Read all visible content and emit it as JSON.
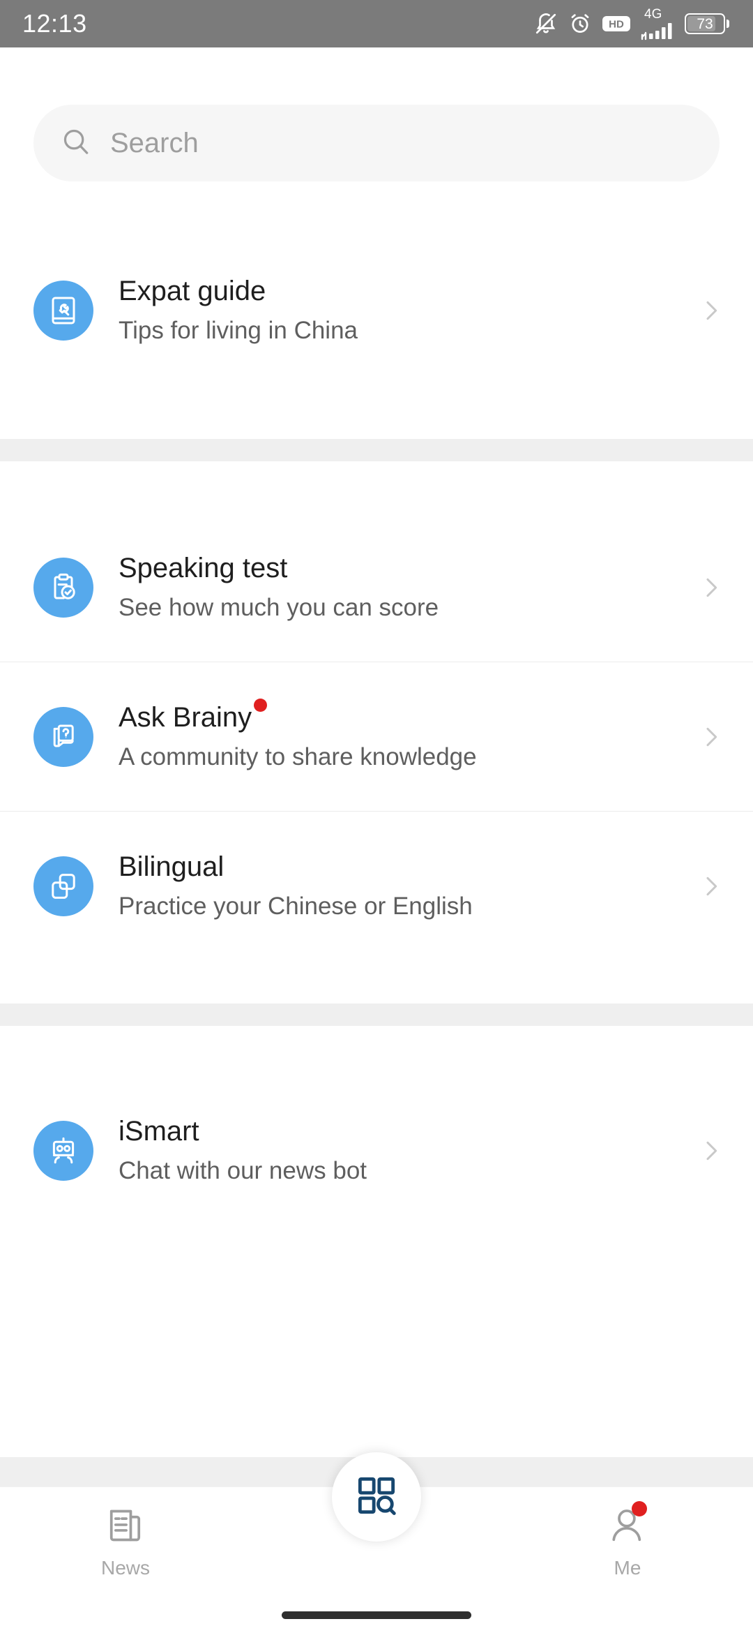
{
  "status_bar": {
    "time": "12:13",
    "network_type": "4G",
    "battery_level": "73",
    "icons": [
      "notifications-off-icon",
      "alarm-icon",
      "hd-icon",
      "signal-icon",
      "battery-icon"
    ]
  },
  "search": {
    "placeholder": "Search",
    "value": "",
    "icon": "search-icon"
  },
  "groups": [
    {
      "items": [
        {
          "id": "expat-guide",
          "title": "Expat guide",
          "subtitle": "Tips for living in China",
          "icon": "book-wrench-icon",
          "badge": false,
          "chevron": "chevron-right-icon"
        }
      ]
    },
    {
      "items": [
        {
          "id": "speaking-test",
          "title": "Speaking test",
          "subtitle": "See how much you can score",
          "icon": "clipboard-check-icon",
          "badge": false,
          "chevron": "chevron-right-icon"
        },
        {
          "id": "ask-brainy",
          "title": "Ask Brainy",
          "subtitle": "A community to share knowledge",
          "icon": "speech-bubble-question-icon",
          "badge": true,
          "chevron": "chevron-right-icon"
        },
        {
          "id": "bilingual",
          "title": "Bilingual",
          "subtitle": "Practice your Chinese or English",
          "icon": "stacked-squares-icon",
          "badge": false,
          "chevron": "chevron-right-icon"
        }
      ]
    },
    {
      "items": [
        {
          "id": "ismart",
          "title": "iSmart",
          "subtitle": "Chat with our news bot",
          "icon": "robot-icon",
          "badge": false,
          "chevron": "chevron-right-icon"
        }
      ]
    }
  ],
  "bottom_nav": {
    "tabs": [
      {
        "id": "news",
        "label": "News",
        "icon": "newspaper-icon",
        "badge": false,
        "active": false
      },
      {
        "id": "services",
        "label": "",
        "icon": "grid-search-icon",
        "badge": false,
        "active": true
      },
      {
        "id": "me",
        "label": "Me",
        "icon": "person-icon",
        "badge": true,
        "active": false
      }
    ]
  },
  "colors": {
    "icon_blue": "#56a9ec",
    "badge_red": "#e02020",
    "fab_icon_navy": "#17476f",
    "status_bar_gray": "#7b7b7b",
    "separator_gray": "#efefef",
    "search_bg": "#f6f6f6",
    "title_text": "#1e1e1e",
    "subtitle_text": "#5e5e5e",
    "tab_label": "#a8a8a8"
  }
}
